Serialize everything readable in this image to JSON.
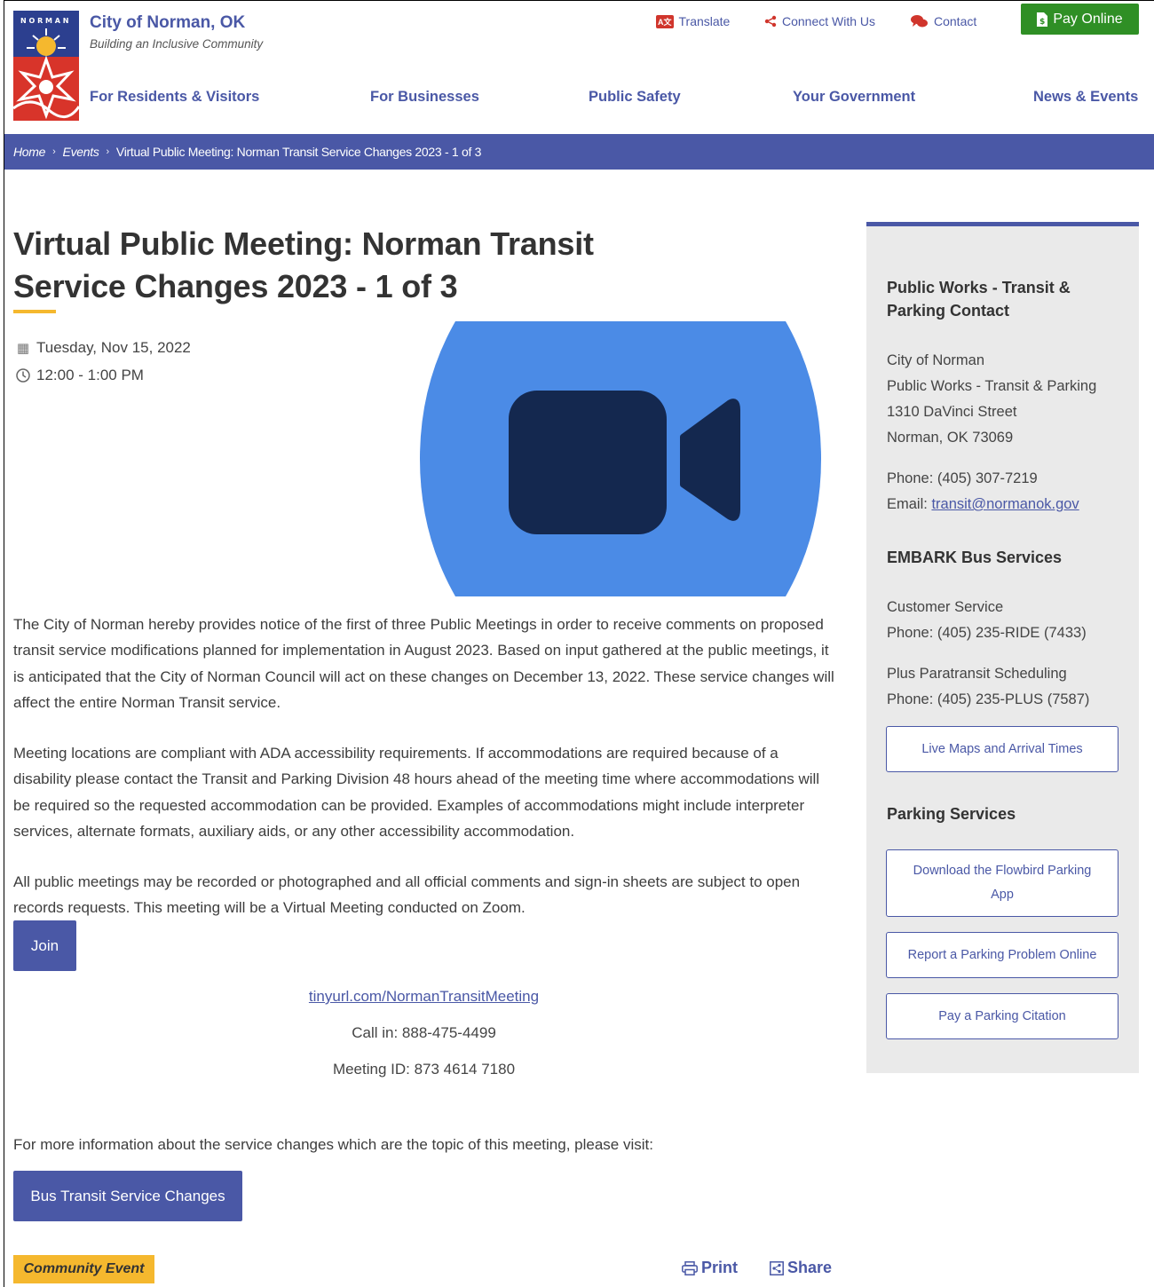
{
  "header": {
    "site_name": "City of Norman, OK",
    "tagline": "Building an Inclusive Community",
    "utility": {
      "translate": "Translate",
      "connect": "Connect With Us",
      "contact": "Contact",
      "pay_online": "Pay Online"
    },
    "nav": [
      "For Residents & Visitors",
      "For Businesses",
      "Public Safety",
      "Your Government",
      "News & Events"
    ]
  },
  "breadcrumb": {
    "home": "Home",
    "events": "Events",
    "current": "Virtual Public Meeting: Norman Transit Service Changes 2023 - 1 of 3"
  },
  "event": {
    "title_line1": "Virtual Public Meeting: Norman Transit",
    "title_line2": "Service Changes 2023 - 1 of 3",
    "date": "Tuesday, Nov 15, 2022",
    "time": "12:00 - 1:00 PM",
    "paragraph1": "The City of Norman hereby provides notice of the first of three Public Meetings in order to receive comments on proposed transit service modifications planned for implementation in August 2023. Based on input gathered at the public meetings, it is anticipated that the City of Norman Council will act on these changes on December 13, 2022. These service changes will affect the entire Norman Transit service.",
    "paragraph2": "Meeting locations are compliant with ADA accessibility requirements. If accommodations are required because of a disability please contact the Transit and Parking Division 48 hours ahead of the meeting time where accommodations will be required so the requested accommodation can be provided. Examples of accommodations might include interpreter services, alternate formats, auxiliary aids, or any other accessibility accommodation.",
    "paragraph3": "All public meetings may be recorded or photographed and all official comments and sign-in sheets are subject to open records requests. This meeting will be a Virtual Meeting conducted on Zoom.",
    "join_label": "Join",
    "meeting_link": "tinyurl.com/NormanTransitMeeting",
    "call_in": "Call in: 888-475-4499",
    "meeting_id": "Meeting ID: 873 4614 7180",
    "more_info": "For more information about the service changes which are the topic of this meeting, please visit:",
    "bus_button": "Bus Transit Service Changes",
    "category_tag": "Community Event",
    "print_label": "Print",
    "share_label": "Share"
  },
  "sidebar": {
    "contact_heading_1": "Public Works - Transit &",
    "contact_heading_2": "Parking Contact",
    "org": "City of Norman",
    "dept": "Public Works - Transit & Parking",
    "street": "1310 DaVinci Street",
    "city": "Norman, OK 73069",
    "phone": "Phone: (405) 307-7219",
    "email_label": "Email: ",
    "email": "transit@normanok.gov",
    "embark_heading": "EMBARK Bus Services",
    "customer_service": "Customer Service",
    "cs_phone": "Phone: (405) 235-RIDE (7433)",
    "paratransit": "Plus Paratransit Scheduling",
    "pt_phone": "Phone: (405) 235-PLUS (7587)",
    "live_maps": "Live Maps and Arrival Times",
    "parking_heading": "Parking Services",
    "flowbird": "Download the Flowbird Parking App",
    "report": "Report a Parking Problem Online",
    "citation": "Pay a Parking Citation"
  },
  "colors": {
    "brand_blue": "#4a58a6",
    "accent_yellow": "#f5b82e",
    "pay_green": "#2f8f25",
    "zoom_blue": "#4b8be6",
    "zoom_navy": "#14284f"
  }
}
